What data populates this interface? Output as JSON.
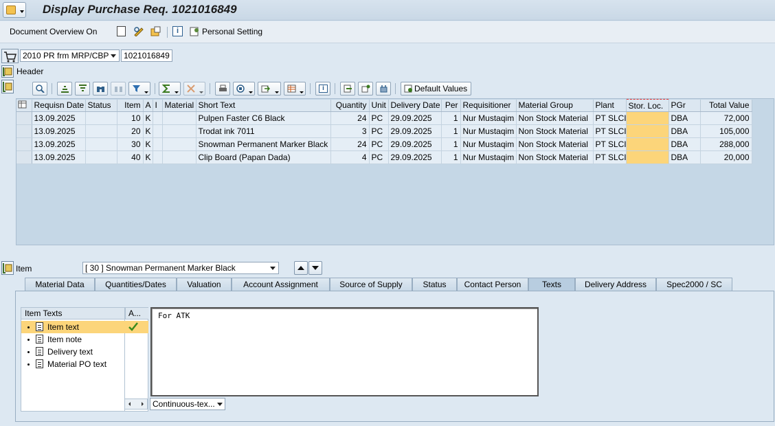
{
  "window": {
    "title": "Display Purchase Req. 1021016849"
  },
  "app_toolbar": {
    "doc_overview_label": "Document Overview On",
    "personal_setting_label": "Personal Setting"
  },
  "pr_selector": {
    "doc_type": "2010 PR frm MRP/CBP",
    "pr_number": "1021016849"
  },
  "header_section": {
    "label": "Header"
  },
  "grid_toolbar": {
    "default_values_label": "Default Values"
  },
  "table": {
    "columns": [
      "Requisn Date",
      "Status",
      "Item",
      "A",
      "I",
      "Material",
      "Short Text",
      "Quantity",
      "Unit",
      "Delivery Date",
      "Per",
      "Requisitioner",
      "Material Group",
      "Plant",
      "Stor. Loc.",
      "PGr",
      "Total Value"
    ],
    "rows": [
      [
        "13.09.2025",
        "",
        "10",
        "K",
        "",
        "",
        "Pulpen Faster C6 Black",
        "24",
        "PC",
        "29.09.2025",
        "1",
        "Nur Mustaqim",
        "Non Stock Material",
        "PT SLCI",
        "",
        "DBA",
        "72,000"
      ],
      [
        "13.09.2025",
        "",
        "20",
        "K",
        "",
        "",
        "Trodat ink 7011",
        "3",
        "PC",
        "29.09.2025",
        "1",
        "Nur Mustaqim",
        "Non Stock Material",
        "PT SLCI",
        "",
        "DBA",
        "105,000"
      ],
      [
        "13.09.2025",
        "",
        "30",
        "K",
        "",
        "",
        "Snowman Permanent Marker Black",
        "24",
        "PC",
        "29.09.2025",
        "1",
        "Nur Mustaqim",
        "Non Stock Material",
        "PT SLCI",
        "",
        "DBA",
        "288,000"
      ],
      [
        "13.09.2025",
        "",
        "40",
        "K",
        "",
        "",
        "Clip Board (Papan Dada)",
        "4",
        "PC",
        "29.09.2025",
        "1",
        "Nur Mustaqim",
        "Non Stock Material",
        "PT SLCI",
        "",
        "DBA",
        "20,000"
      ]
    ]
  },
  "item_section": {
    "label": "Item",
    "selected_item": "[ 30 ] Snowman Permanent Marker Black"
  },
  "tabs": [
    "Material Data",
    "Quantities/Dates",
    "Valuation",
    "Account Assignment",
    "Source of Supply",
    "Status",
    "Contact Person",
    "Texts",
    "Delivery Address",
    "Spec2000 / SC"
  ],
  "active_tab": "Texts",
  "texts_tab": {
    "tree_header": "Item Texts",
    "active_col_header": "A...",
    "items": [
      {
        "label": "Item text",
        "active": true,
        "selected": true
      },
      {
        "label": "Item note",
        "active": false,
        "selected": false
      },
      {
        "label": "Delivery text",
        "active": false,
        "selected": false
      },
      {
        "label": "Material PO text",
        "active": false,
        "selected": false
      }
    ],
    "editor_text": "For ATK",
    "editor_mode": "Continuous-tex..."
  },
  "colors": {
    "background": "#dde8f2",
    "highlight": "#fcd57a",
    "selected_row": "#fcd57a"
  }
}
